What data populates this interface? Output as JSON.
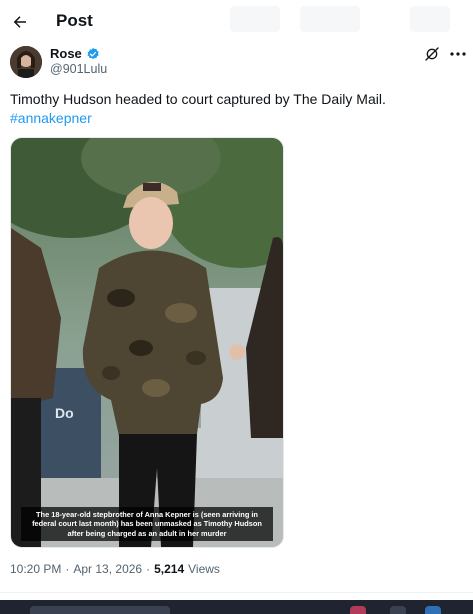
{
  "header": {
    "title": "Post"
  },
  "author": {
    "name": "Rose",
    "handle": "@901Lulu",
    "verified": true
  },
  "tweet": {
    "text": "Timothy Hudson headed to court captured by The Daily Mail.",
    "hashtag": "#annakepner"
  },
  "photo": {
    "caption": "The 18-year-old stepbrother of Anna Kepner is (seen arriving in federal court last month) has been unmasked as Timothy Hudson after being charged as an adult in her murder",
    "sign_text": "Do"
  },
  "meta": {
    "time": "10:20 PM",
    "date": "Apr 13, 2026",
    "separator": "·",
    "views_count": "5,214",
    "views_label": "Views"
  },
  "colors": {
    "accent": "#1d9bf0",
    "text": "#0f1419",
    "muted": "#536471"
  }
}
